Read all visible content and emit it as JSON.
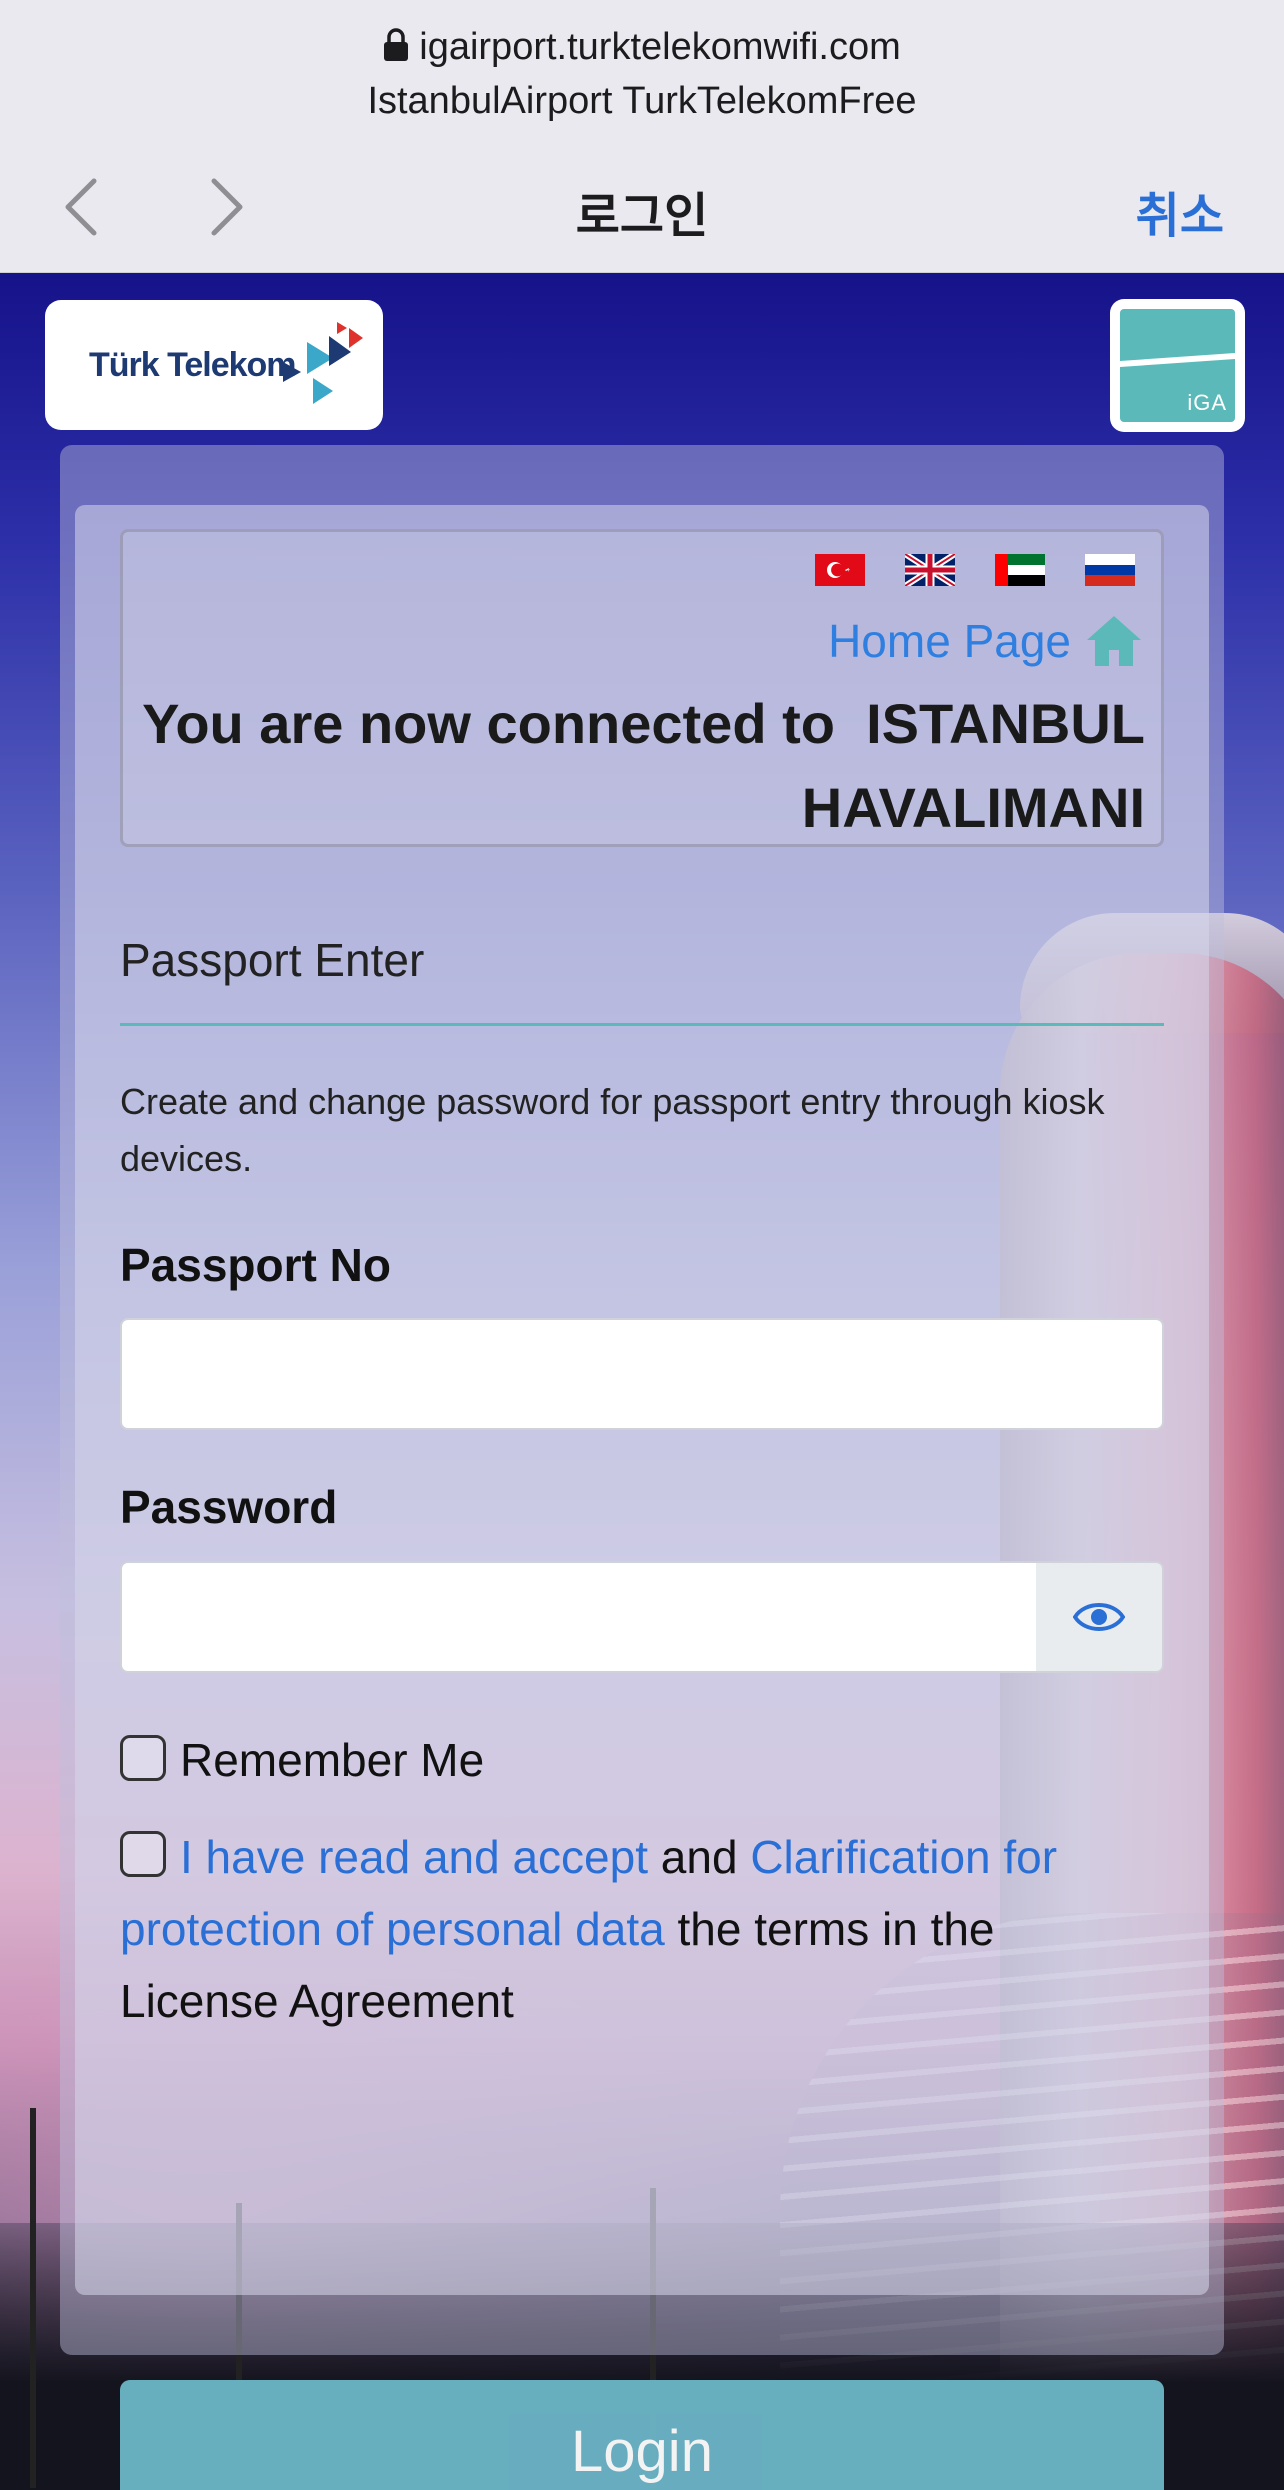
{
  "browser": {
    "url": "igairport.turktelekomwifi.com",
    "ssid": "IstanbulAirport TurkTelekomFree",
    "title": "로그인",
    "cancel_label": "취소"
  },
  "logos": {
    "turk_telekom": "Türk Telekom",
    "iga": "iGA"
  },
  "header": {
    "languages": [
      "turkey-flag",
      "uk-flag",
      "uae-flag",
      "russia-flag"
    ],
    "home_link": "Home Page",
    "connected_line1": "You are now connected to  ISTANBUL",
    "connected_line2": "HAVALIMANI"
  },
  "form": {
    "section_title": "Passport Enter",
    "description": "Create and change password for passport entry through kiosk devices.",
    "passport_label": "Passport No",
    "passport_value": "",
    "password_label": "Password",
    "password_value": "",
    "remember_label": "Remember Me",
    "terms_link1": "I have read and accept",
    "terms_and": " and ",
    "terms_link2": "Clarification for protection of personal data",
    "terms_rest": " the terms in the License Agreement",
    "login_label": "Login"
  },
  "colors": {
    "accent_teal": "#5bbab9",
    "link_blue": "#2a6fd6",
    "login_button": "#6cb6c8"
  }
}
